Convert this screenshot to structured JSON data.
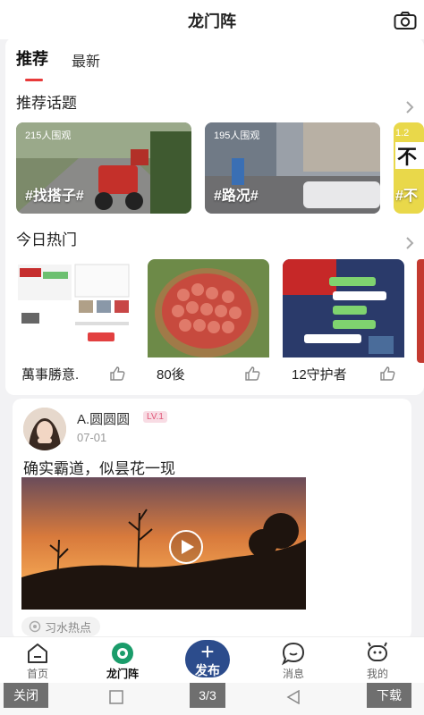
{
  "header": {
    "title": "龙门阵"
  },
  "tabs": [
    {
      "label": "推荐"
    },
    {
      "label": "最新"
    }
  ],
  "topics_section": {
    "title": "推荐话题",
    "items": [
      {
        "viewers": "215人围观",
        "tag": "#找搭子#"
      },
      {
        "viewers": "195人围观",
        "tag": "#路况#"
      },
      {
        "viewers": "1.2",
        "tag": "#不"
      }
    ]
  },
  "hot_section": {
    "title": "今日热门",
    "items": [
      {
        "name": "萬事勝意."
      },
      {
        "name": "80後"
      },
      {
        "name": "12守护者"
      }
    ]
  },
  "post": {
    "username": "A.圆圆圆",
    "level": "LV.1",
    "date": "07-01",
    "text": "确实霸道，似昙花一现",
    "tag": "习水热点"
  },
  "tabbar": {
    "items": [
      {
        "label": "首页"
      },
      {
        "label": "龙门阵"
      },
      {
        "label": "消息"
      },
      {
        "label": "我的"
      }
    ],
    "publish": {
      "label": "发布"
    }
  },
  "system_bar": {
    "close": "关闭",
    "page": "3/3",
    "download": "下载"
  },
  "colors": {
    "accent": "#e83a3a",
    "publish": "#2c4c8c",
    "level": "#e05576"
  }
}
